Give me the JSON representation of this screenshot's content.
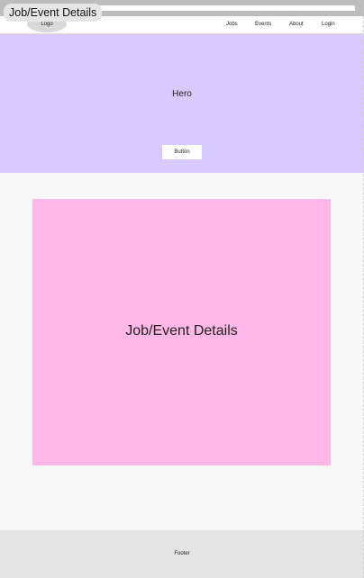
{
  "page": {
    "title": "Job/Event Details"
  },
  "navbar": {
    "logo": "Logo",
    "links": [
      "Jobs",
      "Events",
      "About",
      "Login"
    ]
  },
  "hero": {
    "title": "Hero",
    "button_label": "Button"
  },
  "main": {
    "details_title": "Job/Event Details"
  },
  "footer": {
    "label": "Footer"
  },
  "colors": {
    "hero_bg": "#d9c9ff",
    "details_bg": "#ffb8e8",
    "footer_bg": "#e4e4e4",
    "page_bg": "#f8f8f8"
  }
}
